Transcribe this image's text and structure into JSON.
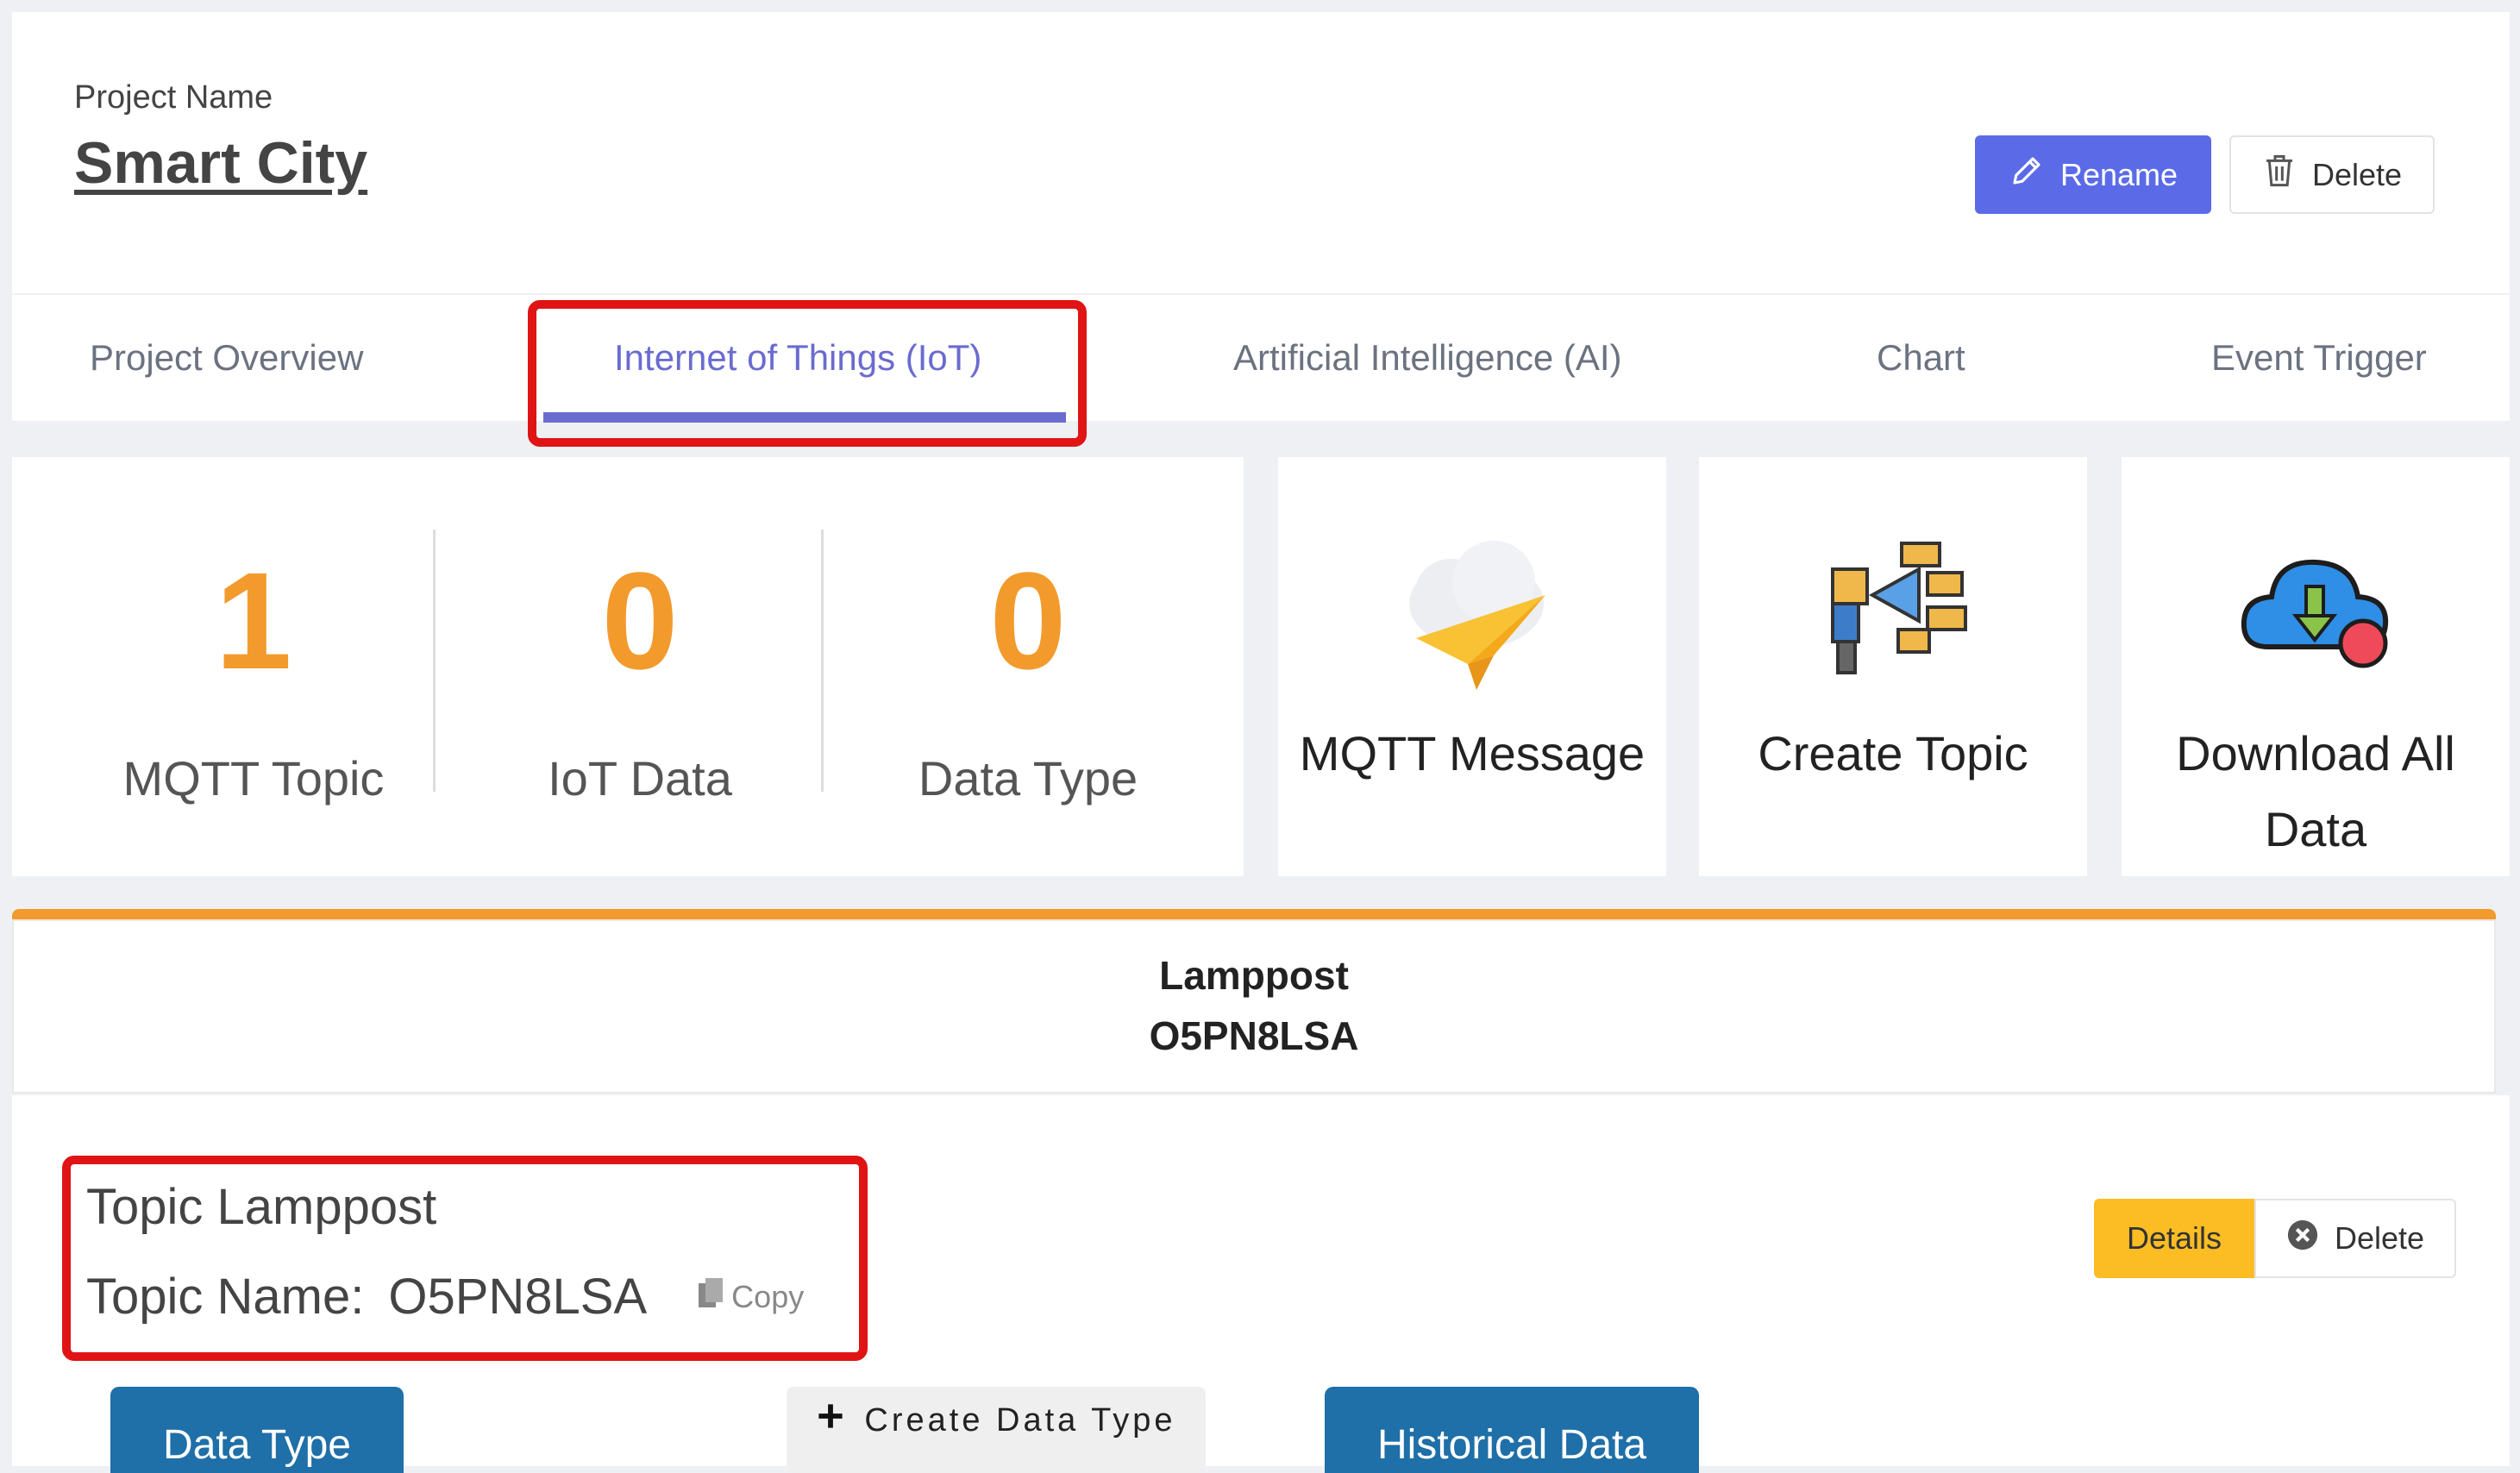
{
  "header": {
    "project_label": "Project Name",
    "project_name": "Smart City",
    "rename_label": "Rename",
    "delete_label": "Delete"
  },
  "tabs": [
    {
      "label": "Project Overview",
      "active": false
    },
    {
      "label": "Internet of Things (IoT)",
      "active": true
    },
    {
      "label": "Artificial Intelligence (AI)",
      "active": false
    },
    {
      "label": "Chart",
      "active": false
    },
    {
      "label": "Event Trigger",
      "active": false
    }
  ],
  "stats": [
    {
      "value": "1",
      "label": "MQTT Topic"
    },
    {
      "value": "0",
      "label": "IoT Data"
    },
    {
      "value": "0",
      "label": "Data Type"
    }
  ],
  "actions": [
    {
      "label": "MQTT Message",
      "icon": "paper-plane-cloud-icon"
    },
    {
      "label": "Create Topic",
      "icon": "broadcast-megaphone-icon"
    },
    {
      "label": "Download All Data",
      "icon": "cloud-download-icon"
    }
  ],
  "topic": {
    "title": "Lamppost",
    "code": "O5PN8LSA",
    "heading": "Topic Lamppost",
    "name_label": "Topic Name:",
    "name_value": "O5PN8LSA",
    "copy_label": "Copy",
    "details_label": "Details",
    "delete_label": "Delete"
  },
  "bottom_buttons": {
    "data_type": "Data Type",
    "create_data_type": "Create Data Type",
    "historical_data": "Historical Data"
  },
  "colors": {
    "accent": "#6a6bd0",
    "rename_button": "#5b6be8",
    "stat_number": "#f39a2d",
    "highlight": "#e01414",
    "details_button": "#fbbd23",
    "blue_button": "#1f6fa8"
  }
}
